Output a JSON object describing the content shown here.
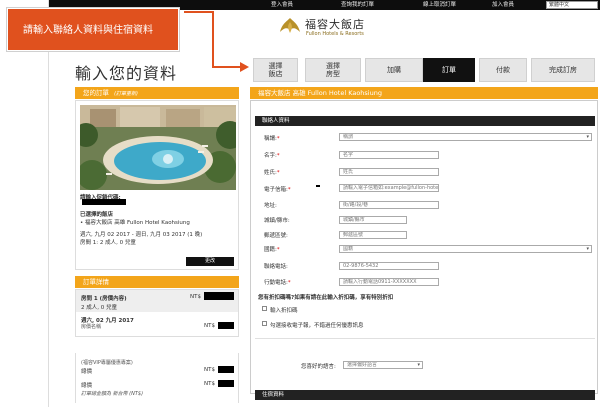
{
  "callout": {
    "text": "請輸入聯絡人資料與住宿資料"
  },
  "topnav": {
    "items": [
      "登入會員",
      "查詢我的訂單",
      "線上取消訂單",
      "加入會員"
    ],
    "language": "繁體中文"
  },
  "brand": {
    "name_cn": "福容大飯店",
    "name_en": "Fullon Hotels & Resorts"
  },
  "page_title": "輸入您的資料",
  "steps": [
    {
      "line1": "選擇",
      "line2": "飯店",
      "active": false
    },
    {
      "line1": "選擇",
      "line2": "房型",
      "active": false
    },
    {
      "line1": "加購",
      "line2": "",
      "active": false
    },
    {
      "line1": "訂單",
      "line2": "",
      "active": true
    },
    {
      "line1": "付款",
      "line2": "",
      "active": false
    },
    {
      "line1": "完成訂房",
      "line2": "",
      "active": false
    }
  ],
  "order_panel": {
    "title": "您的訂單",
    "title_note": "(訂單重新)",
    "promo_code_label": "請輸入促銷代碼:",
    "selected_hotel_label": "已選擇的飯店",
    "hotel_name": "• 福容大飯店 高雄 Fullon Hotel Kaohsiung",
    "dates": "週六, 九月 02 2017 - 週日, 九月 03 2017 (1 晚)",
    "rooms": "房間 1: 2 成人, 0 兒童",
    "more_button": "更改"
  },
  "details_panel": {
    "title": "訂單詳情",
    "room_line": "房間 1 (房價內容)",
    "currency": "NT$",
    "guests": "2 成人, 0 兒童",
    "date": "週六, 02 九月 2017",
    "rate_name": "房價名稱",
    "vip_note": "(福容VIP專屬優惠專案)",
    "subtotal": "總價",
    "total": "總價",
    "footer_note": "訂單總金額為 新台幣 (NT$)"
  },
  "form": {
    "hotel_title": "福容大飯店 高雄 Fullon Hotel Kaohsiung",
    "contact_section": "聯絡人資料",
    "fields": [
      {
        "label": "稱謂:",
        "required": true,
        "value": "稱謂",
        "type": "select"
      },
      {
        "label": "名字:",
        "required": true,
        "value": "名字",
        "type": "text"
      },
      {
        "label": "姓氏:",
        "required": true,
        "value": "姓氏",
        "type": "text"
      },
      {
        "label": "電子信箱:",
        "required": true,
        "value": "請輸入電子信箱如:example@fullon-hotel.com",
        "type": "text"
      },
      {
        "label": "地址:",
        "required": false,
        "value": "街/路/段/巷",
        "type": "text"
      },
      {
        "label": "城鎮/縣市:",
        "required": false,
        "value": "城鎮/縣市",
        "type": "text"
      },
      {
        "label": "郵遞區號:",
        "required": false,
        "value": "郵遞區號",
        "type": "text"
      },
      {
        "label": "國籍:",
        "required": true,
        "value": "國籍",
        "type": "select"
      },
      {
        "label": "聯絡電話:",
        "required": false,
        "value": "02-9876-5432",
        "type": "text"
      },
      {
        "label": "行動電話:",
        "required": true,
        "value": "請輸入行動電話0911-XXXXXXX",
        "type": "text"
      }
    ],
    "discount_prompt": "您有折扣碼嗎?如果有請在此輸入折扣碼，享有特別折扣",
    "discount_checkbox": "輸入折扣碼",
    "newsletter_checkbox": "勾選接收電子報，不錯過任何優惠訊息",
    "language_label": "您喜好的語言:",
    "language_value": "選擇偏好語言",
    "stay_section": "住宿資料"
  }
}
